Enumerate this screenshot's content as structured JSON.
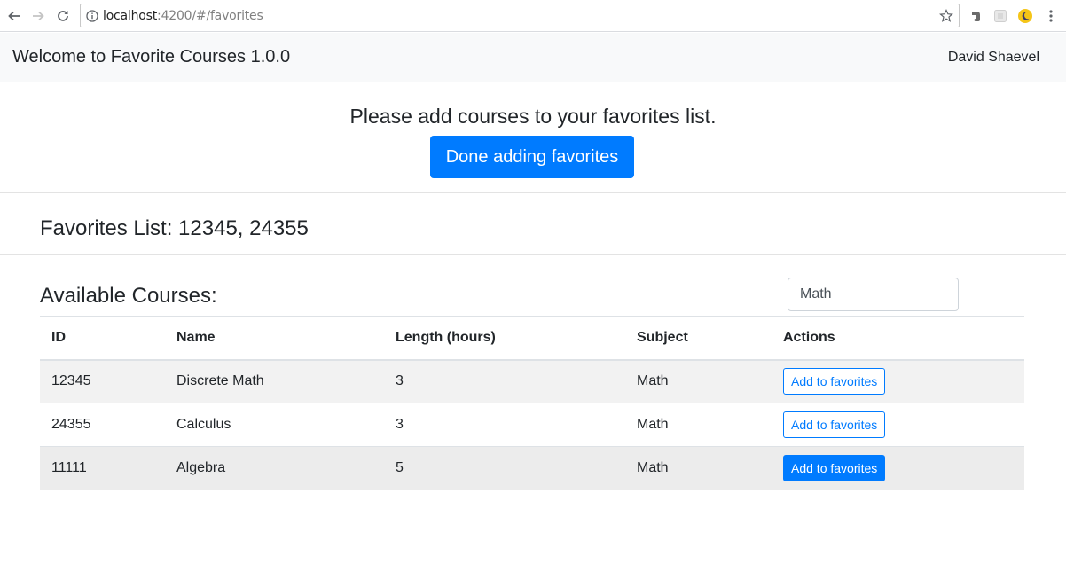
{
  "browser": {
    "url_host": "localhost",
    "url_rest": ":4200/#/favorites"
  },
  "navbar": {
    "brand": "Welcome to Favorite Courses 1.0.0",
    "user": "David Shaevel"
  },
  "header": {
    "prompt": "Please add courses to your favorites list.",
    "done_label": "Done adding favorites"
  },
  "favorites": {
    "title": "Favorites List: 12345, 24355"
  },
  "courses": {
    "title": "Available Courses:",
    "search_value": "Math",
    "columns": [
      "ID",
      "Name",
      "Length (hours)",
      "Subject",
      "Actions"
    ],
    "rows": [
      {
        "id": "12345",
        "name": "Discrete Math",
        "length": "3",
        "subject": "Math",
        "action": "Add to favorites"
      },
      {
        "id": "24355",
        "name": "Calculus",
        "length": "3",
        "subject": "Math",
        "action": "Add to favorites"
      },
      {
        "id": "11111",
        "name": "Algebra",
        "length": "5",
        "subject": "Math",
        "action": "Add to favorites"
      }
    ]
  },
  "colors": {
    "primary": "#007bff",
    "navbar_bg": "#f8f9fa"
  }
}
